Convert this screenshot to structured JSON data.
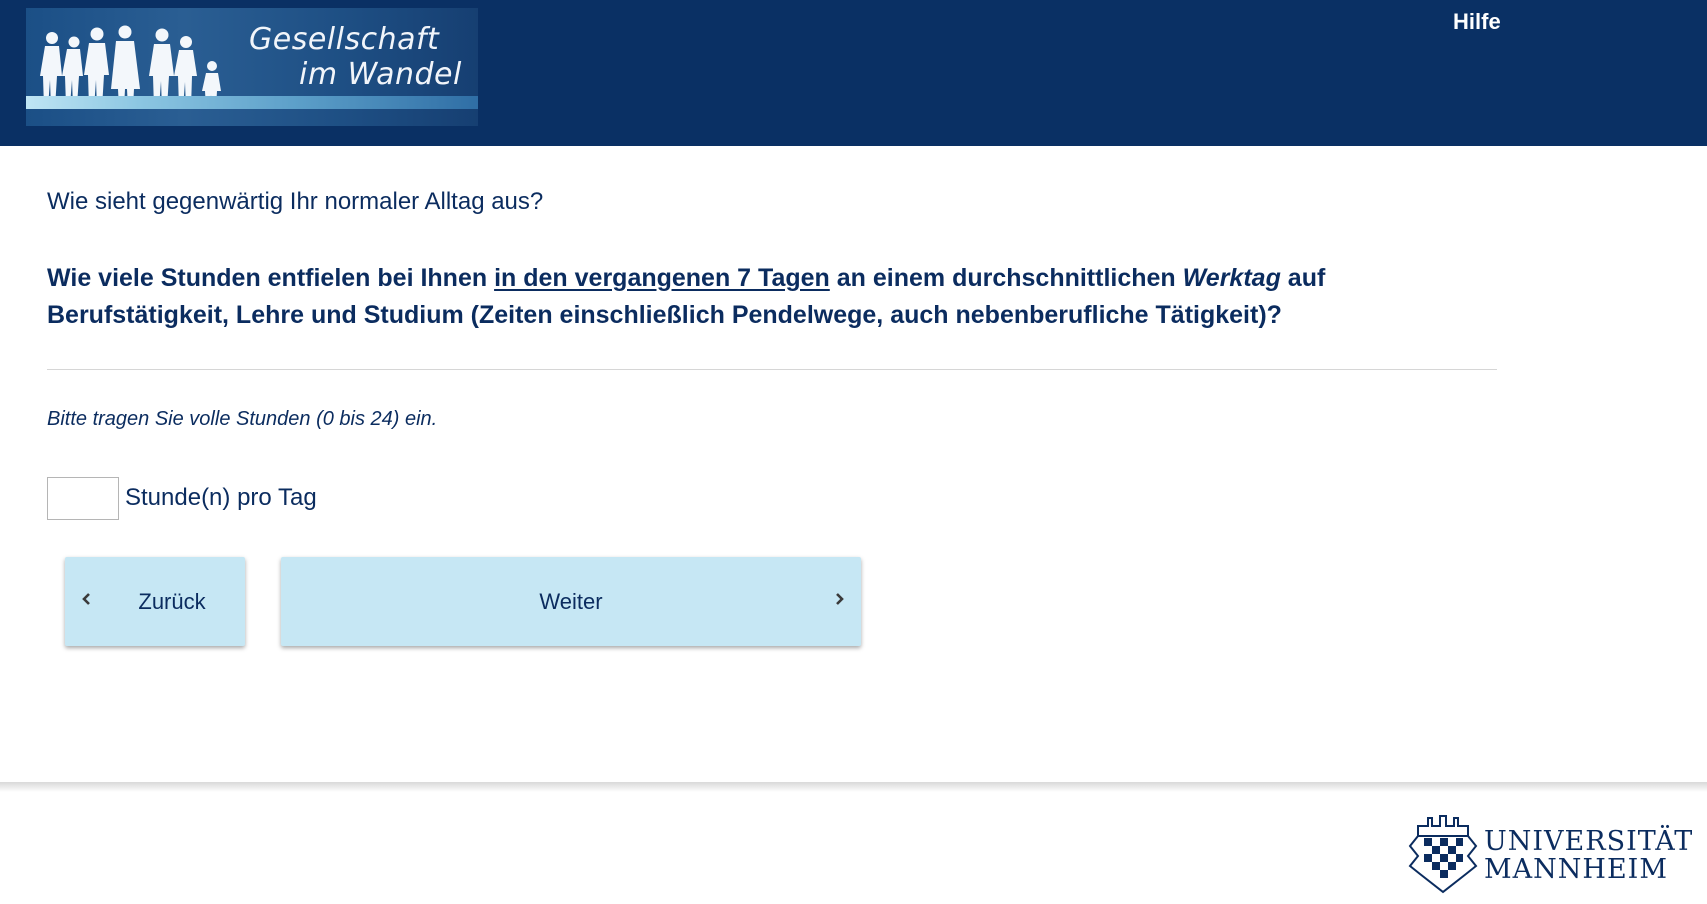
{
  "header": {
    "logo_line1": "Gesellschaft",
    "logo_line2": "im Wandel",
    "help_link": "Hilfe",
    "background_color": "#0a3064"
  },
  "survey": {
    "intro": "Wie sieht gegenwärtig Ihr normaler Alltag aus?",
    "question_part1": "Wie viele Stunden entfielen bei Ihnen ",
    "question_underlined": "in den vergangenen 7 Tagen",
    "question_part2": " an einem durchschnittlichen ",
    "question_emphasis": "Werktag",
    "question_part3": " auf Berufstätigkeit, Lehre und Studium (Zeiten einschließlich Pendelwege, auch nebenberufliche Tätigkeit)?",
    "hint": "Bitte tragen Sie volle Stunden (0 bis 24) ein.",
    "input_value": "",
    "unit_label": "Stunde(n) pro Tag"
  },
  "navigation": {
    "back_label": "Zurück",
    "next_label": "Weiter",
    "button_color": "#c6e7f4"
  },
  "footer": {
    "university_line1": "UNIVERSITÄT",
    "university_line2": "MANNHEIM"
  },
  "icons": {
    "back": "chevron-left-icon",
    "next": "chevron-right-icon",
    "logo": "people-silhouettes-icon",
    "crest": "university-crest-icon"
  }
}
